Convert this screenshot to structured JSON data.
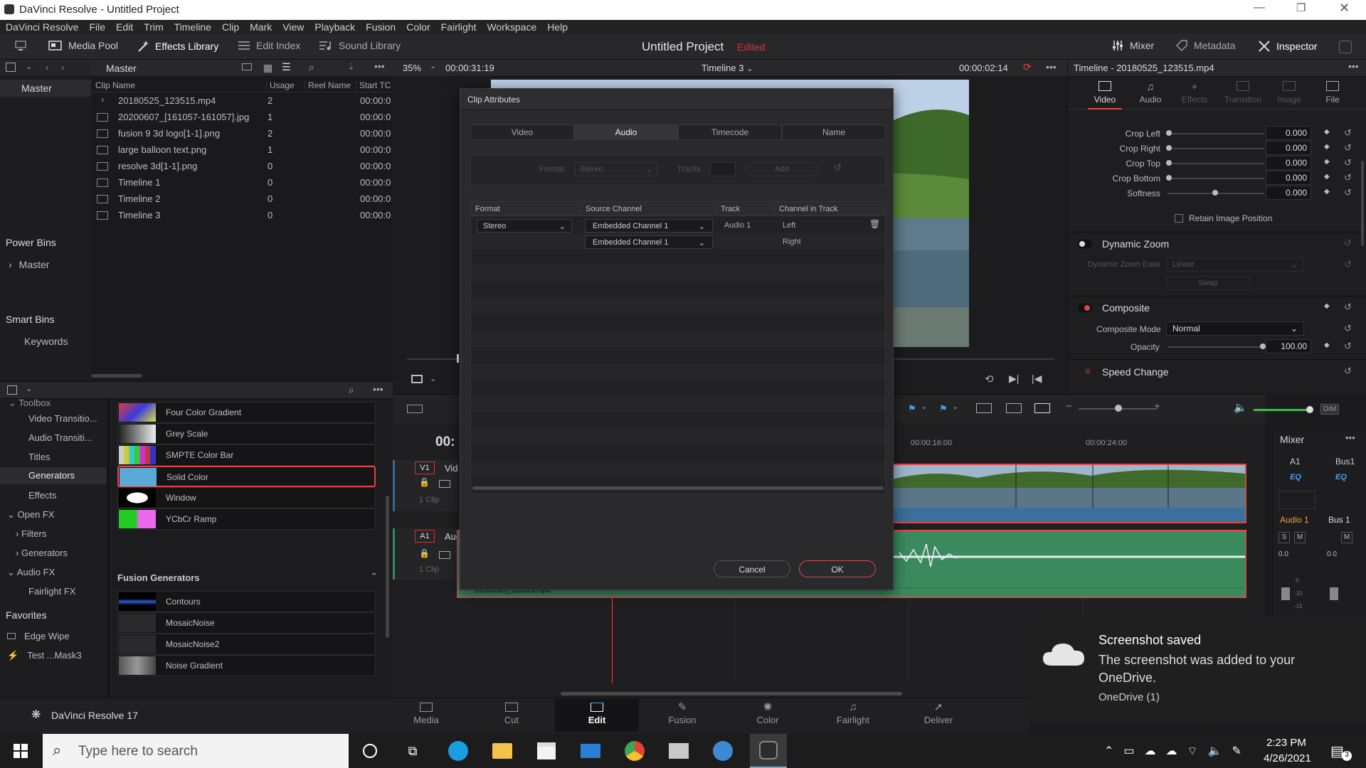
{
  "window": {
    "title": "DaVinci Resolve - Untitled Project"
  },
  "menu": [
    "DaVinci Resolve",
    "File",
    "Edit",
    "Trim",
    "Timeline",
    "Clip",
    "Mark",
    "View",
    "Playback",
    "Fusion",
    "Color",
    "Fairlight",
    "Workspace",
    "Help"
  ],
  "toolbar": {
    "media_pool": "Media Pool",
    "effects_library": "Effects Library",
    "edit_index": "Edit Index",
    "sound_library": "Sound Library",
    "project_title": "Untitled Project",
    "edited": "Edited",
    "mixer": "Mixer",
    "metadata": "Metadata",
    "inspector": "Inspector"
  },
  "media_pool": {
    "bin_title": "Master",
    "columns": [
      "Clip Name",
      "Usage",
      "Reel Name",
      "Start TC"
    ],
    "clips": [
      {
        "name": "20180525_123515.mp4",
        "usage": "2",
        "tc": "00:00:0"
      },
      {
        "name": "20200607_[161057-161057].jpg",
        "usage": "1",
        "tc": "00:00:0"
      },
      {
        "name": "fusion 9 3d logo[1-1].png",
        "usage": "2",
        "tc": "00:00:0"
      },
      {
        "name": "large balloon text.png",
        "usage": "1",
        "tc": "00:00:0"
      },
      {
        "name": "resolve 3d[1-1].png",
        "usage": "0",
        "tc": "00:00:0"
      },
      {
        "name": "Timeline 1",
        "usage": "0",
        "tc": "00:00:0"
      },
      {
        "name": "Timeline 2",
        "usage": "0",
        "tc": "00:00:0"
      },
      {
        "name": "Timeline 3",
        "usage": "0",
        "tc": "00:00:0"
      }
    ]
  },
  "bins": {
    "master": "Master",
    "power_bins": "Power Bins",
    "power_master": "Master",
    "smart_bins": "Smart Bins",
    "keywords": "Keywords"
  },
  "effects": {
    "tree": [
      "Toolbox",
      "Video Transitio...",
      "Audio Transiti...",
      "Titles",
      "Generators",
      "Effects",
      "Open FX",
      "Filters",
      "Generators",
      "Audio FX",
      "Fairlight FX"
    ],
    "favorites": "Favorites",
    "fav_items": [
      "Edge Wipe",
      "Test ...Mask3"
    ],
    "generators": [
      "Four Color Gradient",
      "Grey Scale",
      "SMPTE Color Bar",
      "Solid Color",
      "Window",
      "YCbCr Ramp"
    ],
    "fusion_header": "Fusion Generators",
    "fusion_items": [
      "Contours",
      "MosaicNoise",
      "MosaicNoise2",
      "Noise Gradient"
    ]
  },
  "viewer": {
    "zoom": "35%",
    "duration": "00:00:31:19",
    "timeline": "Timeline 3",
    "timecode": "00:00:02:14"
  },
  "dialog": {
    "title": "Clip Attributes",
    "tabs": [
      "Video",
      "Audio",
      "Timecode",
      "Name"
    ],
    "format_label": "Format",
    "format_value": "Stereo",
    "tracks_label": "Tracks",
    "add_label": "Add",
    "columns": [
      "Format",
      "Source Channel",
      "Track",
      "Channel in Track"
    ],
    "row_format": "Stereo",
    "source1": "Embedded Channel 1",
    "source2": "Embedded Channel 1",
    "track": "Audio 1",
    "ch1": "Left",
    "ch2": "Right",
    "cancel": "Cancel",
    "ok": "OK"
  },
  "timeline": {
    "tc_partial": "00:",
    "v1": "V1",
    "v1_name": "Vid",
    "a1": "A1",
    "a1_name": "Aud",
    "clip_count": "1 Clip",
    "ruler": [
      "00:00:16:00",
      "00:00:24:00"
    ],
    "audio_clip_name": "20180525_123515.mp4"
  },
  "inspector": {
    "title": "Timeline - 20180525_123515.mp4",
    "tabs": [
      "Video",
      "Audio",
      "Effects",
      "Transition",
      "Image",
      "File"
    ],
    "crop": [
      {
        "label": "Crop Left",
        "value": "0.000"
      },
      {
        "label": "Crop Right",
        "value": "0.000"
      },
      {
        "label": "Crop Top",
        "value": "0.000"
      },
      {
        "label": "Crop Bottom",
        "value": "0.000"
      },
      {
        "label": "Softness",
        "value": "0.000"
      }
    ],
    "retain": "Retain Image Position",
    "dynamic_zoom": "Dynamic Zoom",
    "dz_ease": "Dynamic Zoom Ease",
    "dz_ease_value": "Linear",
    "swap": "Swap",
    "composite": "Composite",
    "composite_mode": "Composite Mode",
    "composite_mode_value": "Normal",
    "opacity": "Opacity",
    "opacity_value": "100.00",
    "speed_change": "Speed Change"
  },
  "mixer": {
    "title": "Mixer",
    "a1": "A1",
    "bus1": "Bus1",
    "eq": "EQ",
    "audio1": "Audio 1",
    "bus1b": "Bus 1",
    "s": "S",
    "m": "M",
    "zero": "0.0",
    "scale": [
      "-5",
      "-10",
      "-15"
    ],
    "dim": "DIM"
  },
  "notification": {
    "title": "Screenshot saved",
    "body": "The screenshot was added to your OneDrive.",
    "source": "OneDrive (1)"
  },
  "pages": [
    "Media",
    "Cut",
    "Edit",
    "Fusion",
    "Color",
    "Fairlight",
    "Deliver"
  ],
  "status": {
    "app": "DaVinci Resolve 17"
  },
  "taskbar": {
    "search": "Type here to search",
    "time": "2:23 PM",
    "date": "4/26/2021",
    "notif_count": "3"
  },
  "colors": {
    "accent_red": "#e04646",
    "active_blue": "#4a9fe8",
    "solid_color": "#5aa9d6",
    "audio_green": "#3b8a5e"
  }
}
